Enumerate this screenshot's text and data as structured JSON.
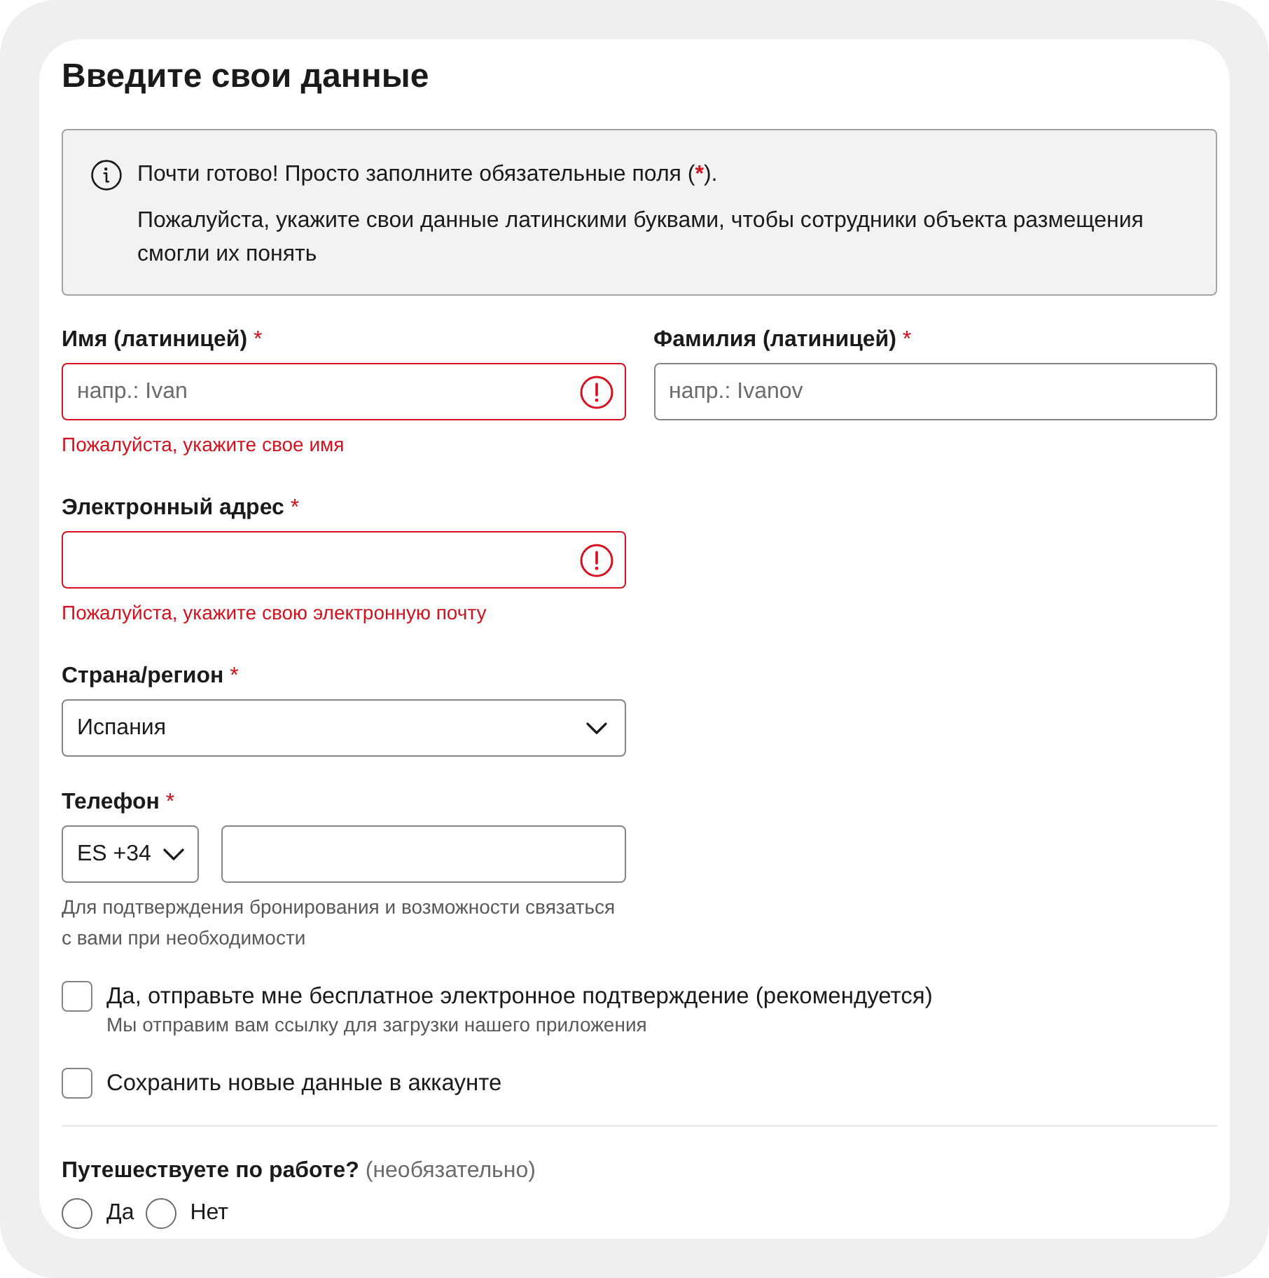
{
  "title": "Введите свои данные",
  "notice": {
    "headline": {
      "text": "Почти готово! Просто заполните обязательные поля (",
      "mark": "*",
      "end": ")."
    },
    "detail": "Пожалуйста, укажите свои данные латинскими буквами, чтобы сотрудники объекта размещения смогли их понять"
  },
  "rows": [
    [
      {
        "kind": "text",
        "label": "Имя (латиницей)",
        "required_mark": "*",
        "placeholder": "напр.: Ivan",
        "invalid": true,
        "error": "Пожалуйста, укажите свое имя"
      },
      {
        "kind": "text",
        "label": "Фамилия (латиницей)",
        "required_mark": "*",
        "placeholder": "напр.: Ivanov",
        "invalid": false
      }
    ],
    [
      {
        "kind": "text",
        "label": "Электронный адрес",
        "required_mark": "*",
        "invalid": true,
        "error": "Пожалуйста, укажите свою электронную почту"
      }
    ],
    [
      {
        "kind": "select",
        "label": "Страна/регион",
        "required_mark": "*",
        "value": "Испания"
      }
    ],
    [
      {
        "kind": "phone",
        "label": "Телефон",
        "required_mark": "*",
        "code": "ES +34",
        "invalid": false,
        "hint": "Для подтверждения бронирования и возможности связаться с вами при необходимости"
      }
    ]
  ],
  "checkboxes": [
    {
      "label": "Да, отправьте мне бесплатное электронное подтверждение (рекомендуется)",
      "note": "Мы отправим вам ссылку для загрузки нашего приложения",
      "checked": false
    },
    {
      "label": "Сохранить новые данные в аккаунте",
      "checked": false
    }
  ],
  "business_trip": {
    "question": "Путешествуете по работе?",
    "note": "(необязательно)",
    "options": [
      {
        "label": "Да",
        "selected": false
      },
      {
        "label": "Нет",
        "selected": false
      }
    ]
  }
}
